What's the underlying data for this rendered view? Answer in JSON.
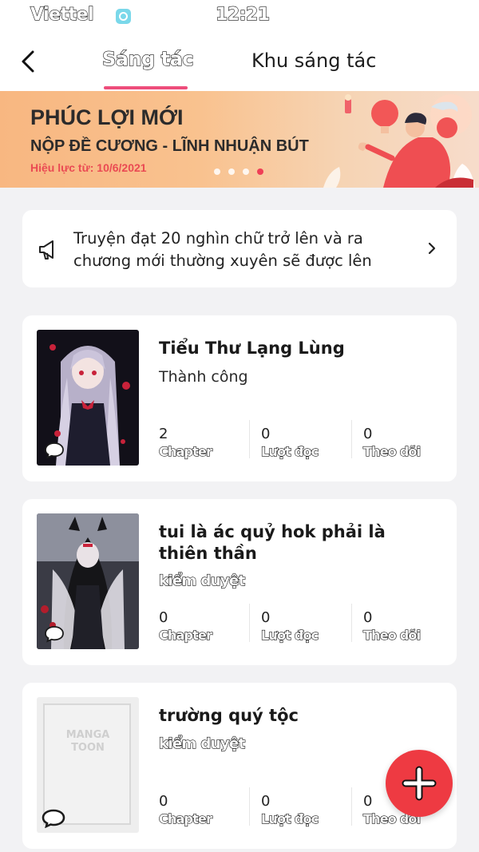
{
  "status_bar": {
    "carrier": "Viettel",
    "time": "12:21"
  },
  "nav": {
    "tabs": [
      {
        "label": "Sáng tác",
        "active": true
      },
      {
        "label": "Khu sáng tác",
        "active": false
      }
    ]
  },
  "banner": {
    "title": "PHÚC LỢI MỚI",
    "subtitle": "NỘP ĐỀ CƯƠNG - LĨNH NHUẬN BÚT",
    "date": "Hiệu lực từ: 10/6/2021",
    "slide_count": 4,
    "active_slide": 4
  },
  "notice": {
    "text": "Truyện đạt 20 nghìn chữ trở lên và ra chương mới thường xuyên sẽ được lên"
  },
  "works": [
    {
      "title": "Tiểu Thư Lạng Lùng",
      "status": "Thành công",
      "stats": [
        {
          "value": "2",
          "label": "Chapter"
        },
        {
          "value": "0",
          "label": "Lượt đọc"
        },
        {
          "value": "0",
          "label": "Theo dõi"
        }
      ]
    },
    {
      "title": "tui là ác quỷ hok phải là thiên thần",
      "status": "kiểm duyệt",
      "stats": [
        {
          "value": "0",
          "label": "Chapter"
        },
        {
          "value": "0",
          "label": "Lượt đọc"
        },
        {
          "value": "0",
          "label": "Theo dõi"
        }
      ]
    },
    {
      "title": "trường quý tộc",
      "status": "kiểm duyệt",
      "cover_placeholder": [
        "MANGA",
        "TOON"
      ],
      "stats": [
        {
          "value": "0",
          "label": "Chapter"
        },
        {
          "value": "0",
          "label": "Lượt đọc"
        },
        {
          "value": "0",
          "label": "Theo dõi"
        }
      ]
    }
  ],
  "colors": {
    "accent": "#ee4d7b",
    "fab": "#ee3a42",
    "banner_red": "#ea4a53"
  },
  "icons": {
    "back": "chevron-left-icon",
    "notice": "megaphone-icon",
    "notice_more": "chevron-right-icon",
    "comment": "chat-bubble-icon",
    "fab": "plus-icon"
  }
}
